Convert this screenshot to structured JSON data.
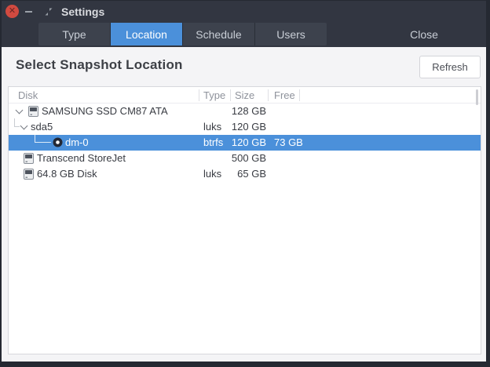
{
  "window": {
    "title": "Settings"
  },
  "tabs": {
    "items": [
      {
        "label": "Type",
        "active": false
      },
      {
        "label": "Location",
        "active": true
      },
      {
        "label": "Schedule",
        "active": false
      },
      {
        "label": "Users",
        "active": false
      }
    ],
    "close_label": "Close"
  },
  "main": {
    "heading": "Select Snapshot Location",
    "refresh_label": "Refresh"
  },
  "table": {
    "columns": [
      "Disk",
      "Type",
      "Size",
      "Free"
    ],
    "rows": [
      {
        "name": "SAMSUNG SSD CM87 ATA",
        "type": "",
        "size": "128 GB",
        "free": "",
        "icon": "disk",
        "expander": true,
        "level": 0,
        "selected": false
      },
      {
        "name": "sda5",
        "type": "luks",
        "size": "120 GB",
        "free": "",
        "icon": "none",
        "expander": true,
        "level": 1,
        "selected": false
      },
      {
        "name": "dm-0",
        "type": "btrfs",
        "size": "120 GB",
        "free": "73 GB",
        "icon": "volume",
        "expander": false,
        "level": 2,
        "selected": true
      },
      {
        "name": "Transcend StoreJet",
        "type": "",
        "size": "500 GB",
        "free": "",
        "icon": "disk",
        "expander": false,
        "level": 0,
        "selected": false
      },
      {
        "name": "64.8 GB Disk",
        "type": "luks",
        "size": "65 GB",
        "free": "",
        "icon": "disk",
        "expander": false,
        "level": 0,
        "selected": false
      }
    ]
  },
  "colors": {
    "accent": "#4b90da",
    "close_button": "#d14a40",
    "titlebar_bg": "#323641",
    "content_bg": "#f4f4f6"
  }
}
